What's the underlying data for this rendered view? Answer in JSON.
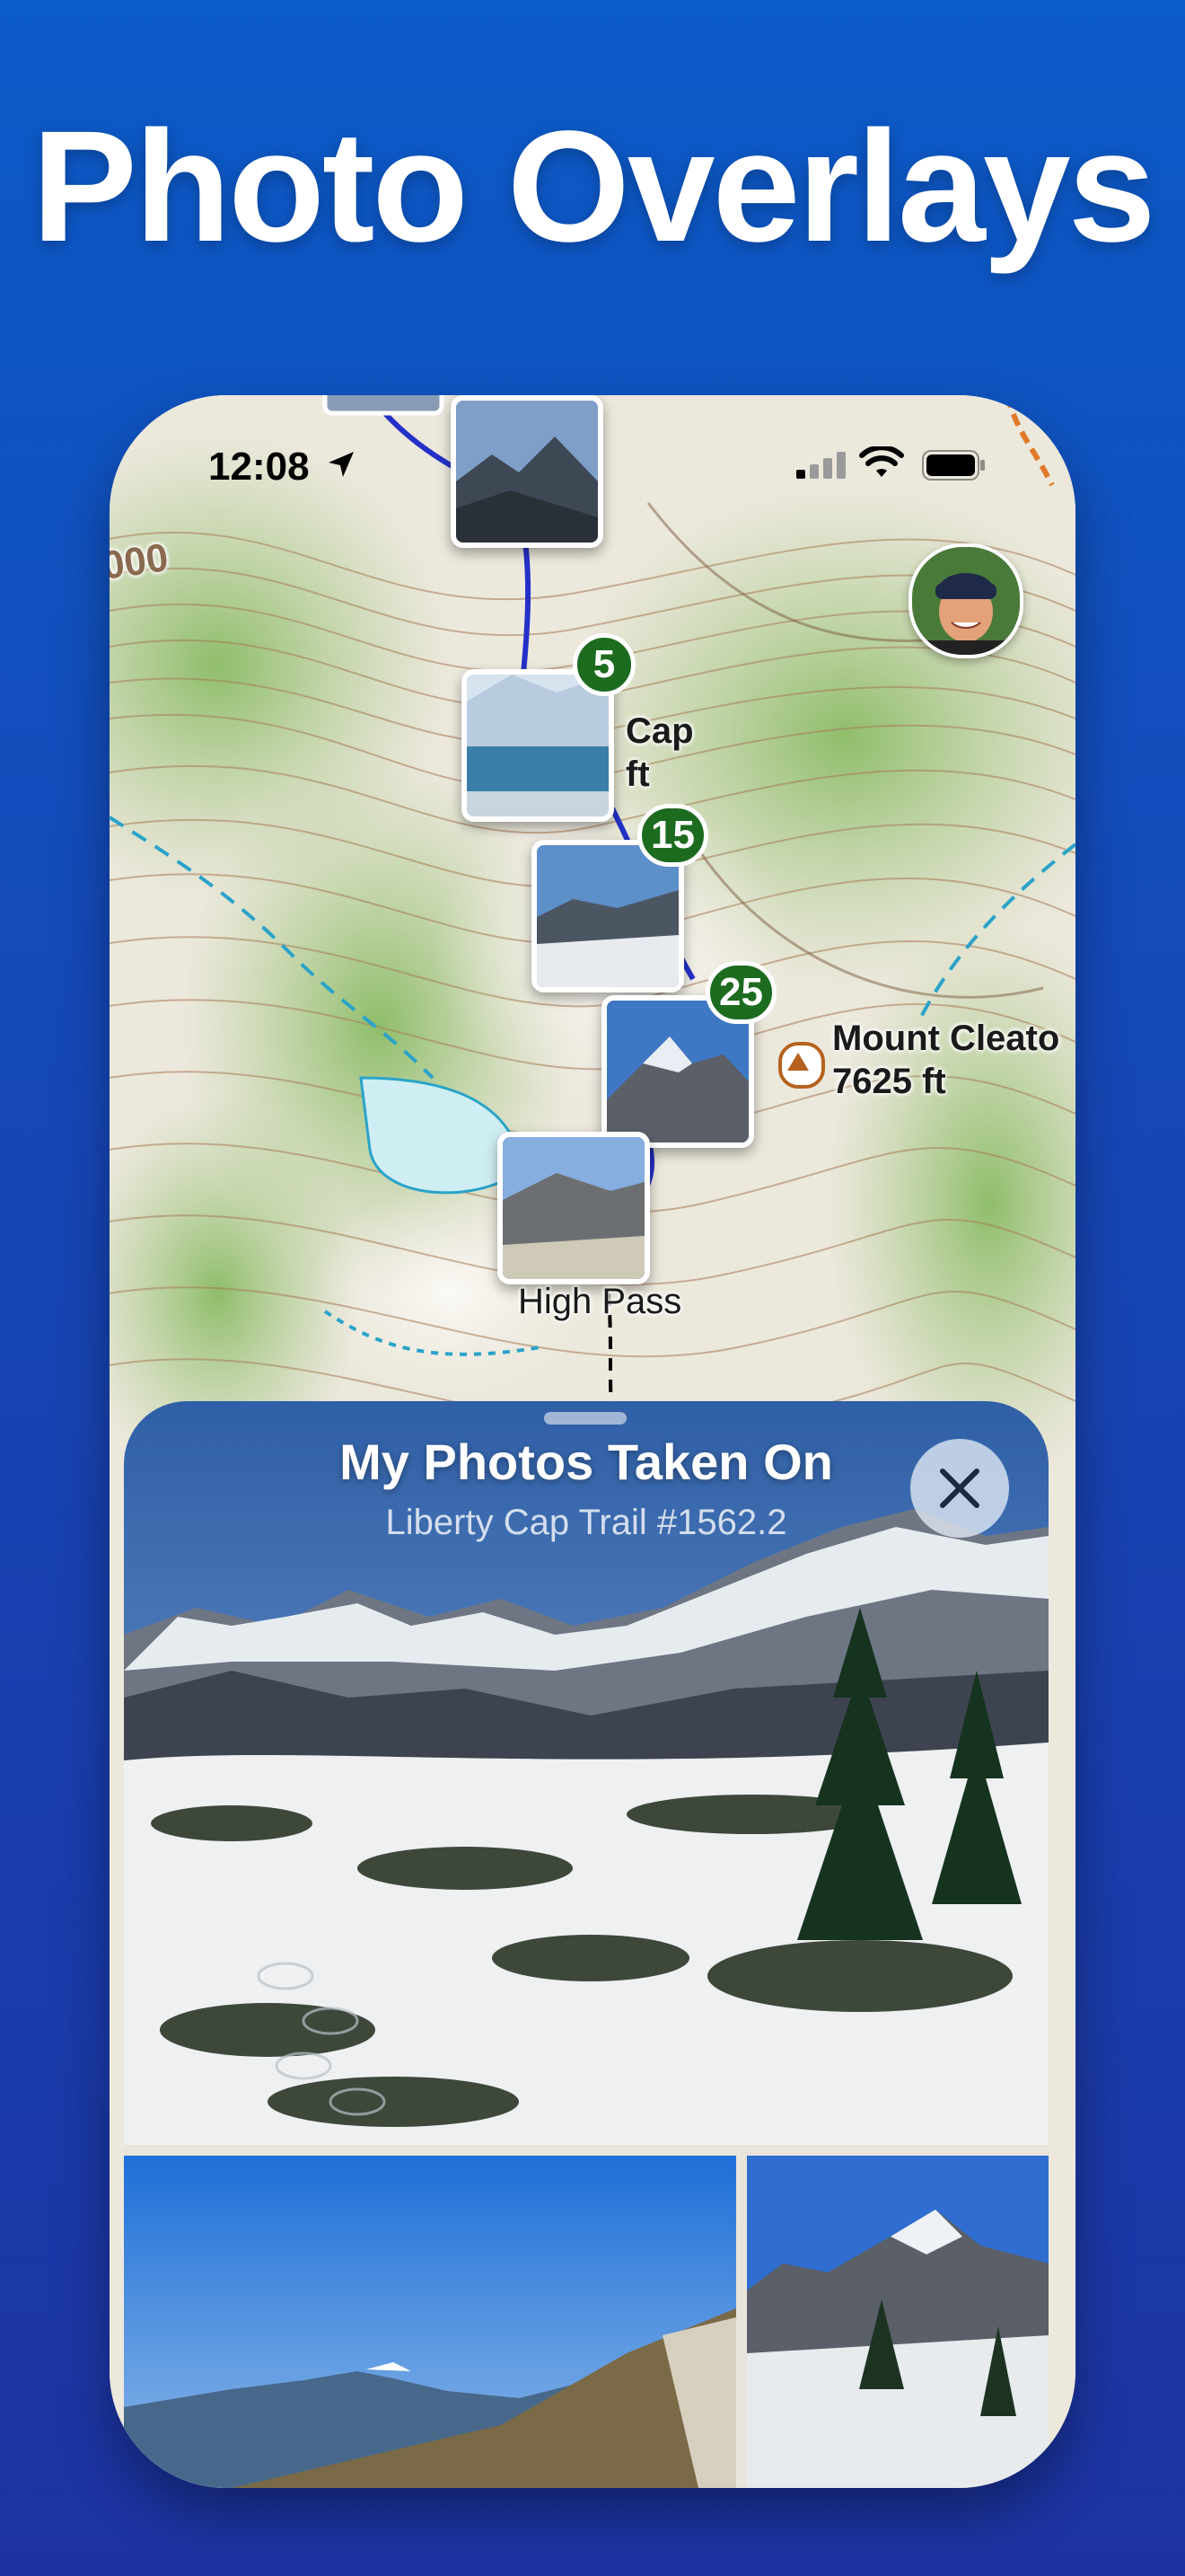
{
  "headline": "Photo Overlays",
  "status_bar": {
    "time": "12:08",
    "icons": [
      "location-arrow-icon",
      "cellular-signal-icon",
      "wifi-icon",
      "battery-icon"
    ]
  },
  "map": {
    "labels": {
      "cap_line1": "Cap",
      "cap_line2": "ft",
      "peak_name": "Mount Cleato",
      "peak_elevation": "7625 ft",
      "pass": "High Pass",
      "contour": "000"
    },
    "photo_badges": [
      "5",
      "15",
      "25"
    ],
    "colors": {
      "badge": "#1c6b1f",
      "trail": "#2430c8",
      "peak_icon": "#b4621e"
    }
  },
  "sheet": {
    "title": "My Photos Taken On",
    "subtitle": "Liberty Cap Trail #1562.2",
    "close_icon": "close-x-icon"
  },
  "colors": {
    "background_top": "#0b5bc8",
    "background_bottom": "#1d33a2"
  }
}
